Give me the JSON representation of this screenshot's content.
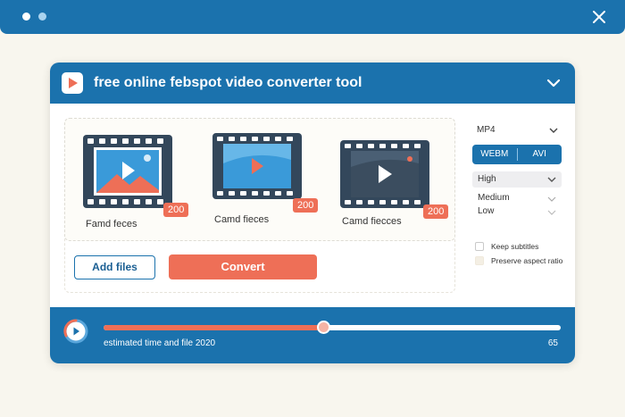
{
  "window": {
    "title": "free online febspot video converter tool"
  },
  "files": [
    {
      "name": "Famd feces",
      "badge": "200",
      "thumb_icon": "landscape-video-thumbnail-icon"
    },
    {
      "name": "Camd fieces",
      "badge": "200",
      "thumb_icon": "play-video-thumbnail-icon"
    },
    {
      "name": "Camd fiecces",
      "badge": "200",
      "thumb_icon": "dark-video-thumbnail-icon"
    }
  ],
  "actions": {
    "add_files": "Add files",
    "convert": "Convert"
  },
  "format": {
    "selected": "MP4",
    "options": [
      "WEBM",
      "AVI"
    ]
  },
  "quality": {
    "selected": "High",
    "options": [
      "Medium",
      "Low"
    ]
  },
  "settings": {
    "keep_subtitles": "Keep subtitles",
    "preserve_aspect": "Preserve aspect ratio"
  },
  "progress": {
    "status": "estimated time and file 2020",
    "value": 65,
    "fraction": 0.48
  },
  "colors": {
    "brand_blue": "#1b72ad",
    "accent_orange": "#ee6f57",
    "background": "#f8f6ee"
  }
}
